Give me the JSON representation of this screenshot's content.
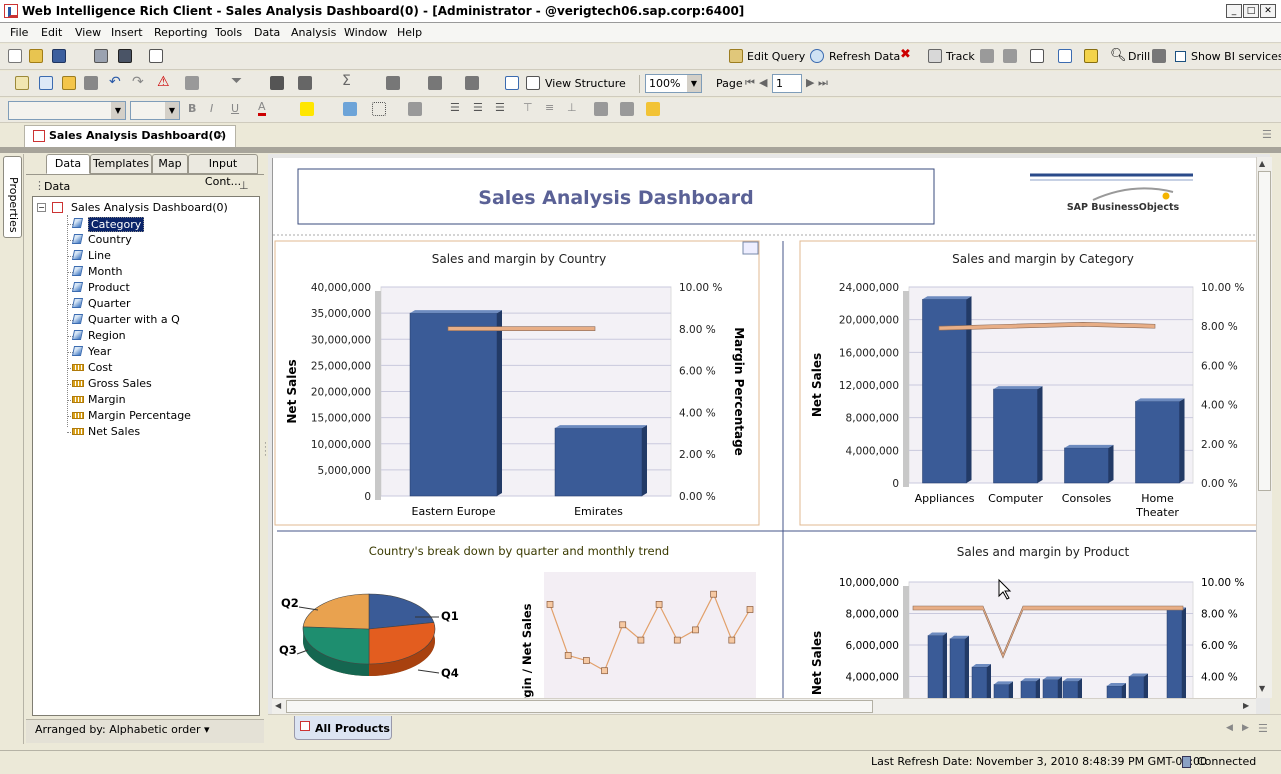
{
  "window": {
    "title": "Web Intelligence Rich Client - Sales Analysis Dashboard(0) - [Administrator - @verigtech06.sap.corp:6400]"
  },
  "menu": [
    "File",
    "Edit",
    "View",
    "Insert",
    "Reporting",
    "Tools",
    "Data",
    "Analysis",
    "Window",
    "Help"
  ],
  "toolbar1": {
    "edit_query": "Edit Query",
    "refresh": "Refresh Data",
    "track": "Track",
    "drill": "Drill",
    "show_bi": "Show BI services"
  },
  "toolbar2": {
    "view_structure": "View Structure",
    "zoom": "100%",
    "page_label": "Page",
    "page_value": "1"
  },
  "doc_tab": {
    "label": "Sales Analysis Dashboard(0)",
    "close": "×"
  },
  "side_tab": {
    "label": "Properties"
  },
  "panel": {
    "tabs": [
      "Data",
      "Templates",
      "Map",
      "Input Cont..."
    ],
    "header": "Data",
    "root": "Sales Analysis Dashboard(0)",
    "dimensions": [
      "Category",
      "Country",
      "Line",
      "Month",
      "Product",
      "Quarter",
      "Quarter with a Q",
      "Region",
      "Year"
    ],
    "measures": [
      "Cost",
      "Gross Sales",
      "Margin",
      "Margin Percentage",
      "Net Sales"
    ],
    "arranged": "Arranged by: Alphabetic order ▾"
  },
  "report": {
    "title": "Sales Analysis Dashboard",
    "logo": "SAP BusinessObjects",
    "report_tab": "All Products"
  },
  "chart_data": [
    {
      "type": "bar",
      "title": "Sales and margin by Country",
      "categories": [
        "Eastern Europe",
        "Emirates"
      ],
      "series": [
        {
          "name": "Net Sales",
          "values": [
            35000000,
            13000000
          ]
        },
        {
          "name": "Margin Percentage",
          "values": [
            8.1,
            8.1
          ]
        }
      ],
      "ylabel": "Net Sales",
      "y2label": "Margin Percentage",
      "ylim": [
        0,
        40000000
      ],
      "y2lim": [
        0,
        10
      ],
      "yticks": [
        "0",
        "5,000,000",
        "10,000,000",
        "15,000,000",
        "20,000,000",
        "25,000,000",
        "30,000,000",
        "35,000,000",
        "40,000,000"
      ],
      "y2ticks": [
        "0.00 %",
        "2.00 %",
        "4.00 %",
        "6.00 %",
        "8.00 %",
        "10.00 %"
      ]
    },
    {
      "type": "bar",
      "title": "Sales and margin by Category",
      "categories": [
        "Appliances",
        "Computer",
        "Consoles",
        "Home Theater"
      ],
      "series": [
        {
          "name": "Net Sales",
          "values": [
            22500000,
            11500000,
            4300000,
            10000000
          ]
        },
        {
          "name": "Margin Percentage",
          "values": [
            8.0,
            8.1,
            8.2,
            8.1
          ]
        }
      ],
      "ylabel": "Net Sales",
      "ylim": [
        0,
        24000000
      ],
      "y2lim": [
        0,
        10
      ],
      "yticks": [
        "0",
        "4,000,000",
        "8,000,000",
        "12,000,000",
        "16,000,000",
        "20,000,000",
        "24,000,000"
      ],
      "y2ticks": [
        "0.00 %",
        "2.00 %",
        "4.00 %",
        "6.00 %",
        "8.00 %",
        "10.00 %"
      ]
    },
    {
      "type": "pie",
      "title": "Country's break down by quarter and monthly trend",
      "categories": [
        "Q1",
        "Q2",
        "Q3",
        "Q4"
      ],
      "values": [
        22,
        24,
        26,
        28
      ]
    },
    {
      "type": "line",
      "ylabel": "Margin / Net Sales",
      "values": [
        8,
        3,
        2.5,
        1.5,
        6,
        4.5,
        8,
        4.5,
        5.5,
        9,
        4.5,
        7.5
      ]
    },
    {
      "type": "bar",
      "title": "Sales and margin by Product",
      "ylabel": "Net Sales",
      "ylim": [
        0,
        10000000
      ],
      "y2lim": [
        0,
        10
      ],
      "yticks": [
        "4,000,000",
        "6,000,000",
        "8,000,000",
        "10,000,000"
      ],
      "y2ticks": [
        "4.00 %",
        "6.00 %",
        "8.00 %",
        "10.00 %"
      ],
      "values": [
        6600000,
        6400000,
        4600000,
        3500000,
        3700000,
        3800000,
        3700000,
        3400000,
        4000000,
        8200000
      ]
    }
  ],
  "status": {
    "refresh": "Last Refresh Date: November 3, 2010 8:48:39 PM GMT-07:00",
    "connected": "Connected"
  }
}
